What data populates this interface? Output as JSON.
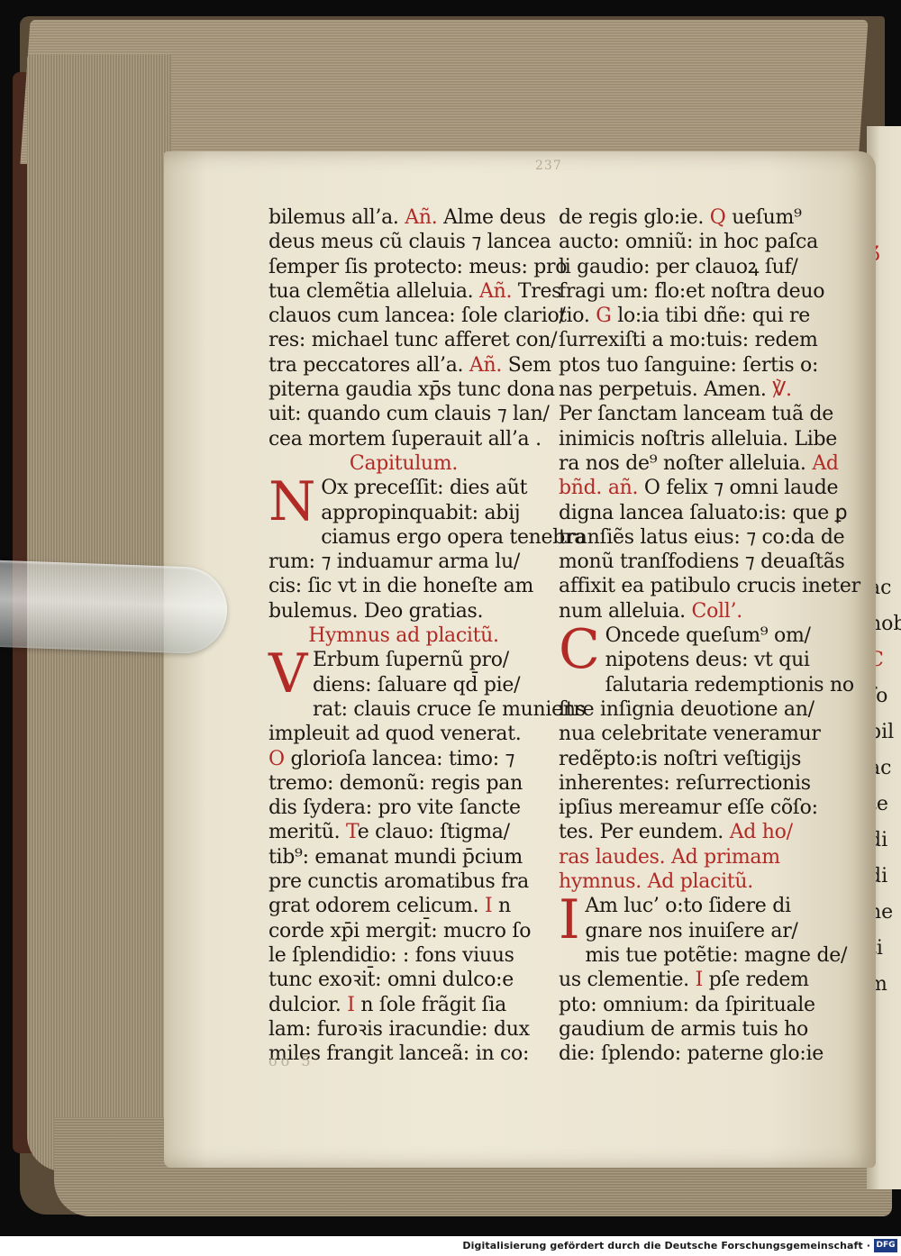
{
  "folio": "237",
  "left_column": [
    [
      {
        "t": "bilemus all’a. "
      },
      {
        "t": "Añ.",
        "r": true
      },
      {
        "t": " Alme deus"
      }
    ],
    [
      {
        "t": "deus meus cũ clauis ⁊ lancea"
      }
    ],
    [
      {
        "t": "ſemper ſis protecto: meus: pro"
      }
    ],
    [
      {
        "t": "tua clemẽtia alleluia. "
      },
      {
        "t": "Añ.",
        "r": true
      },
      {
        "t": " Tres"
      }
    ],
    [
      {
        "t": "clauos cum lancea: ſole clario/"
      }
    ],
    [
      {
        "t": "res: michael tunc afferet con/"
      }
    ],
    [
      {
        "t": "tra peccatores all’a. "
      },
      {
        "t": "Añ.",
        "r": true
      },
      {
        "t": " Sem"
      }
    ],
    [
      {
        "t": "piterna gaudia xp̄s tunc dona"
      }
    ],
    [
      {
        "t": "uit: quando cum clauis ⁊ lan/"
      }
    ],
    [
      {
        "t": "cea mortem ſuperauit all’a ."
      }
    ],
    [
      {
        "t": "Capitulum.",
        "r": true,
        "h": true
      }
    ],
    [
      {
        "t": "N",
        "r": true,
        "d": true
      },
      {
        "t": "Ox preceſſit: dies aũt"
      }
    ],
    [
      {
        "t": "appropinquabit: abij"
      }
    ],
    [
      {
        "t": "ciamus ergo opera tenebra"
      }
    ],
    [
      {
        "t": "rum: ⁊ induamur arma lu/"
      }
    ],
    [
      {
        "t": "cis: ſic vt in die honeſte am"
      }
    ],
    [
      {
        "t": "bulemus. Deo gratias."
      }
    ],
    [
      {
        "t": "Hymnus ad placitũ.",
        "r": true,
        "h": true
      }
    ],
    [
      {
        "t": "V",
        "r": true,
        "d": true
      },
      {
        "t": "Erbum ſupernũ pro/"
      }
    ],
    [
      {
        "t": "diens: ſaluare qd̄ pie/"
      }
    ],
    [
      {
        "t": "rat: clauis cruce ſe muniens"
      }
    ],
    [
      {
        "t": "impleuit ad quod venerat."
      }
    ],
    [
      {
        "t": "O",
        "r": true
      },
      {
        "t": " glorioſa lancea: timo: ⁊"
      }
    ],
    [
      {
        "t": "tremo: demonũ: regis pan"
      }
    ],
    [
      {
        "t": "dis ſydera: pro vite ſancte"
      }
    ],
    [
      {
        "t": "meritũ. "
      },
      {
        "t": "T",
        "r": true
      },
      {
        "t": "e clauo: ſtigma/"
      }
    ],
    [
      {
        "t": "tib⁹: emanat mundi p̄cium"
      }
    ],
    [
      {
        "t": "pre cunctis aromatibus fra"
      }
    ],
    [
      {
        "t": "grat odorem celicum. "
      },
      {
        "t": "I",
        "r": true
      },
      {
        "t": " n"
      }
    ],
    [
      {
        "t": "corde xp̄i mergit̄: mucro ſo"
      }
    ],
    [
      {
        "t": "le ſplendidio: : fons viuus"
      }
    ],
    [
      {
        "t": "tunc exoꝛit̄: omni dulco:e"
      }
    ],
    [
      {
        "t": "dulcior. "
      },
      {
        "t": "I",
        "r": true
      },
      {
        "t": " n ſole frãgit ſia"
      }
    ],
    [
      {
        "t": "lam: furoꝛis iracundie: dux"
      }
    ],
    [
      {
        "t": "miles frangit lanceã: in co:"
      }
    ]
  ],
  "right_column": [
    [
      {
        "t": "de regis glo:ie. "
      },
      {
        "t": "Q",
        "r": true
      },
      {
        "t": " ueſum⁹"
      }
    ],
    [
      {
        "t": "aucto: omniũ: in hoc paſca"
      }
    ],
    [
      {
        "t": "li gaudio: per clauoꝝ ſuf/"
      }
    ],
    [
      {
        "t": "fragi um: flo:et noſtra deuo"
      }
    ],
    [
      {
        "t": "tio. "
      },
      {
        "t": "G",
        "r": true
      },
      {
        "t": " lo:ia tibi dñe: qui re"
      }
    ],
    [
      {
        "t": "ſurrexiſti a mo:tuis: redem"
      }
    ],
    [
      {
        "t": "ptos tuo ſanguine: ſertis o:"
      }
    ],
    [
      {
        "t": "nas perpetuis. Amen. "
      },
      {
        "t": "℣.",
        "r": true
      }
    ],
    [
      {
        "t": "Per ſanctam lanceam tuã de"
      }
    ],
    [
      {
        "t": "inimicis noſtris alleluia. Libe"
      }
    ],
    [
      {
        "t": "ra nos de⁹ noſter alleluia. "
      },
      {
        "t": "Ad",
        "r": true
      }
    ],
    [
      {
        "t": "bñd. añ.",
        "r": true
      },
      {
        "t": " O felix ⁊ omni laude"
      }
    ],
    [
      {
        "t": "digna lancea ſaluato:is: que ꝑ"
      }
    ],
    [
      {
        "t": "tranſiẽs latus eius: ⁊ co:da de"
      }
    ],
    [
      {
        "t": "monũ tranſfodiens ⁊ deuaſtãs"
      }
    ],
    [
      {
        "t": "affixit ea patibulo crucis ineter"
      }
    ],
    [
      {
        "t": "num alleluia. "
      },
      {
        "t": "Coll’.",
        "r": true
      }
    ],
    [
      {
        "t": "C",
        "r": true,
        "d": true
      },
      {
        "t": "Oncede queſum⁹ om/"
      }
    ],
    [
      {
        "t": "nipotens deus: vt qui"
      }
    ],
    [
      {
        "t": "ſalutaria redemptionis no"
      }
    ],
    [
      {
        "t": "ſtre inſignia deuotione an/"
      }
    ],
    [
      {
        "t": "nua celebritate veneramur"
      }
    ],
    [
      {
        "t": "redẽpto:is noſtri veſtigijs"
      }
    ],
    [
      {
        "t": "inherentes: reſurrectionis"
      }
    ],
    [
      {
        "t": "ipſius mereamur eſſe cõſo:"
      }
    ],
    [
      {
        "t": "tes. Per eundem. "
      },
      {
        "t": "Ad ho/",
        "r": true
      }
    ],
    [
      {
        "t": "ras laudes.   Ad primam",
        "r": true
      }
    ],
    [
      {
        "t": "hymnus.  Ad placitũ.",
        "r": true
      }
    ],
    [
      {
        "t": "I",
        "r": true,
        "d": true
      },
      {
        "t": "Am luc’ o:to ſidere di"
      }
    ],
    [
      {
        "t": "gnare nos inuiſere ar/"
      }
    ],
    [
      {
        "t": "mis tue potẽtie: magne de/"
      }
    ],
    [
      {
        "t": "us clementie. "
      },
      {
        "t": "I",
        "r": true
      },
      {
        "t": " pſe redem"
      }
    ],
    [
      {
        "t": "pto: omnium: da ſpirituale"
      }
    ],
    [
      {
        "t": "gaudium de armis tuis ho"
      }
    ],
    [
      {
        "t": "die: ſplendo: paterne glo:ie"
      }
    ]
  ],
  "next_page_fragments": [
    "Ʒ",
    "ac",
    "nob",
    "C",
    "fo",
    "bil",
    "ac",
    "te",
    "di",
    "di",
    "ne",
    "ti",
    "m"
  ],
  "bottom_mark": "oo 5",
  "footer_text": "Digitalisierung gefördert durch die Deutsche Forschungsgemeinschaft ·",
  "footer_logo": "DFG",
  "colors": {
    "ink": "#1c1712",
    "rubric": "#b22a26",
    "paper": "#eee8d6"
  }
}
